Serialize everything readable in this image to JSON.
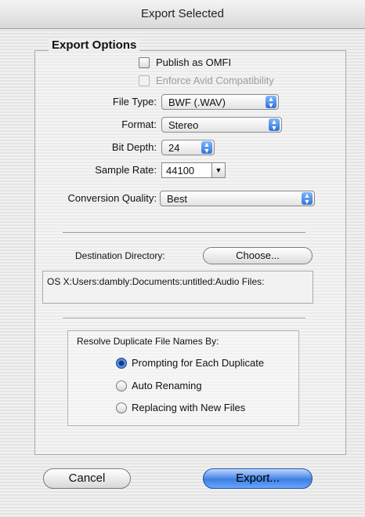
{
  "window": {
    "title": "Export Selected"
  },
  "export_options": {
    "group_title": "Export Options",
    "publish_omfi": {
      "label": "Publish as OMFI",
      "checked": false
    },
    "enforce_avid": {
      "label": "Enforce Avid Compatibility",
      "checked": false,
      "enabled": false
    },
    "file_type": {
      "label": "File Type:",
      "value": "BWF (.WAV)"
    },
    "format": {
      "label": "Format:",
      "value": "Stereo"
    },
    "bit_depth": {
      "label": "Bit Depth:",
      "value": "24"
    },
    "sample_rate": {
      "label": "Sample Rate:",
      "value": "44100"
    },
    "conversion_quality": {
      "label": "Conversion Quality:",
      "value": "Best"
    }
  },
  "destination": {
    "label": "Destination Directory:",
    "choose_label": "Choose...",
    "path": "OS X:Users:dambly:Documents:untitled:Audio Files:"
  },
  "resolve": {
    "title": "Resolve Duplicate File Names By:",
    "options": [
      {
        "label": "Prompting for Each Duplicate",
        "selected": true
      },
      {
        "label": "Auto Renaming",
        "selected": false
      },
      {
        "label": "Replacing with New Files",
        "selected": false
      }
    ]
  },
  "buttons": {
    "cancel": "Cancel",
    "export": "Export..."
  },
  "colors": {
    "accent": "#3e7fe3"
  },
  "icons": {
    "popup_arrows": "up-down-arrows-icon",
    "combo_arrow": "chevron-down-icon"
  }
}
